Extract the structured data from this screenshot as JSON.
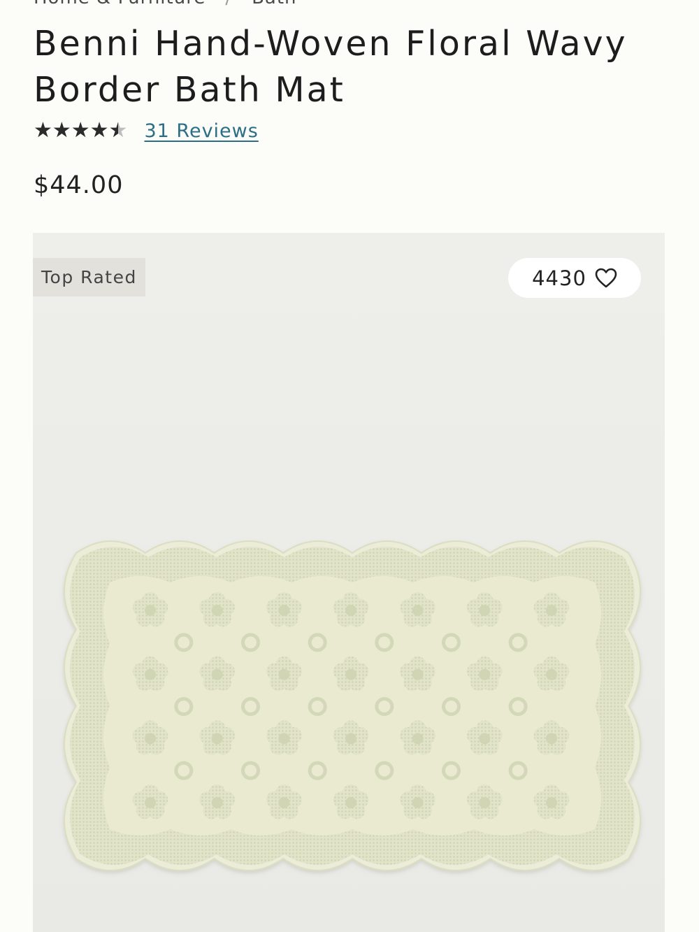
{
  "breadcrumb": [
    "Home & Furniture",
    "/",
    "Bath"
  ],
  "product": {
    "title": "Benni Hand-Woven Floral Wavy Border Bath Mat",
    "rating_value": 4.5,
    "rating_max": 5,
    "reviews_label": "31 Reviews",
    "price": "$44.00"
  },
  "image": {
    "badge": "Top Rated",
    "favorites_count": "4430"
  },
  "icons": {
    "star": "star-icon",
    "heart": "heart-icon"
  },
  "colors": {
    "background": "#fcfcf8",
    "link": "#2a6f86",
    "image_bg": "#ecece8",
    "mat_base": "#e7e8d2",
    "mat_pattern": "#d3d8b9"
  }
}
